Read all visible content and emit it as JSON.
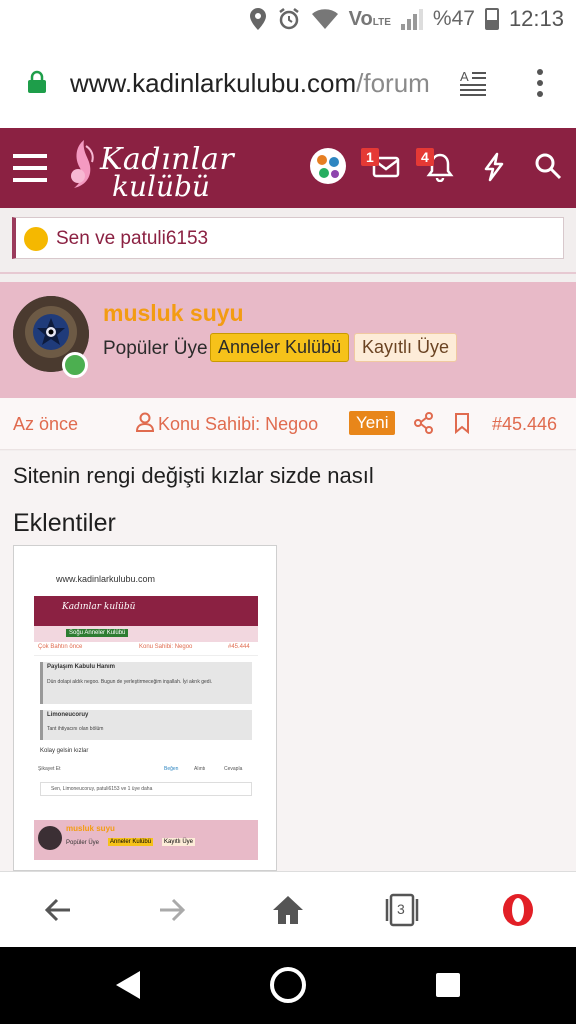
{
  "status_bar": {
    "battery": "%47",
    "time": "12:13",
    "icons": [
      "location-icon",
      "alarm-icon",
      "wifi-icon",
      "volte-icon",
      "signal-icon",
      "battery-icon"
    ]
  },
  "browser": {
    "url_host": "www.kadinlarkulubu.com",
    "url_path": "/forum",
    "icons": [
      "lock-icon",
      "reader-mode-icon",
      "overflow-menu-icon"
    ]
  },
  "site_header": {
    "logo_line1": "Kadınlar",
    "logo_line2": "kulübü",
    "messages_badge": "1",
    "alerts_badge": "4",
    "brand_color": "#8b2142"
  },
  "reactions": {
    "text": "Sen ve patuli6153"
  },
  "post": {
    "username": "musluk suyu",
    "role": "Popüler Üye",
    "badge_gold": "Anneler Kulübü",
    "badge_light": "Kayıtlı Üye",
    "time": "Az önce",
    "owner": "Konu Sahibi: Negoo",
    "new_label": "Yeni",
    "post_number": "#45.446",
    "message": "Sitenin rengi değişti kızlar sizde nasıl",
    "attachments_title": "Eklentiler"
  },
  "thumbnail": {
    "url": "www.kadinlarkulubu.com",
    "logo": "Kadınlar kulübü",
    "gold_badge": "Soğu Anneler Kulübü",
    "time": "Çok Bahtın önce",
    "owner": "Konu Sahibi: Negoo",
    "post_number": "#45.444",
    "quote1_title": "Paylaşım Kabulu Hanım",
    "quote1_text": "Dün dolapi aldık negoo. Bugun de yerleştirmeceğim inşallah. İyi akrık gedi.",
    "quote2_title": "Limoneucoruy",
    "quote2_text": "Tant ihtiyacını olan bölüm",
    "reply_text": "Kolay gelsin kızlar",
    "footer_left": "Şikayet Et",
    "footer_like": "Beğen",
    "footer_quote": "Alıntı",
    "footer_reply": "Cevapla",
    "reactions": "Sen, Limoneucoruy, patuli6153 ve 1 üye daha",
    "username": "musluk suyu",
    "role": "Popüler Üye",
    "role_badge": "Anneler Kulübü",
    "member_badge": "Kayıtlı Üye"
  },
  "bottom_nav": {
    "tab_count": "3",
    "icons": [
      "back-icon",
      "forward-icon",
      "home-icon",
      "tabs-icon",
      "opera-icon"
    ]
  },
  "android_nav": {
    "icons": [
      "nav-back-icon",
      "nav-home-icon",
      "nav-recents-icon"
    ]
  }
}
